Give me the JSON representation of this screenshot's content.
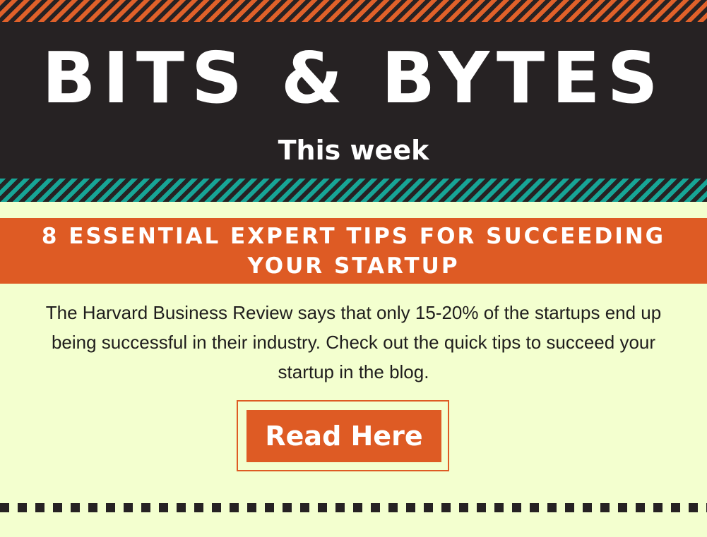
{
  "header": {
    "title": "BITS & BYTES",
    "subtitle": "This week"
  },
  "article": {
    "title": "8 ESSENTIAL EXPERT TIPS FOR SUCCEEDING YOUR STARTUP",
    "body": "The Harvard Business Review says that only 15-20% of the startups end up being successful in their industry. Check out the quick tips to succeed your startup in the blog.",
    "cta_label": "Read Here"
  },
  "colors": {
    "dark": "#262223",
    "orange": "#de5b24",
    "teal": "#17a596",
    "background": "#f3ffcf",
    "text": "#1f1d1d"
  }
}
